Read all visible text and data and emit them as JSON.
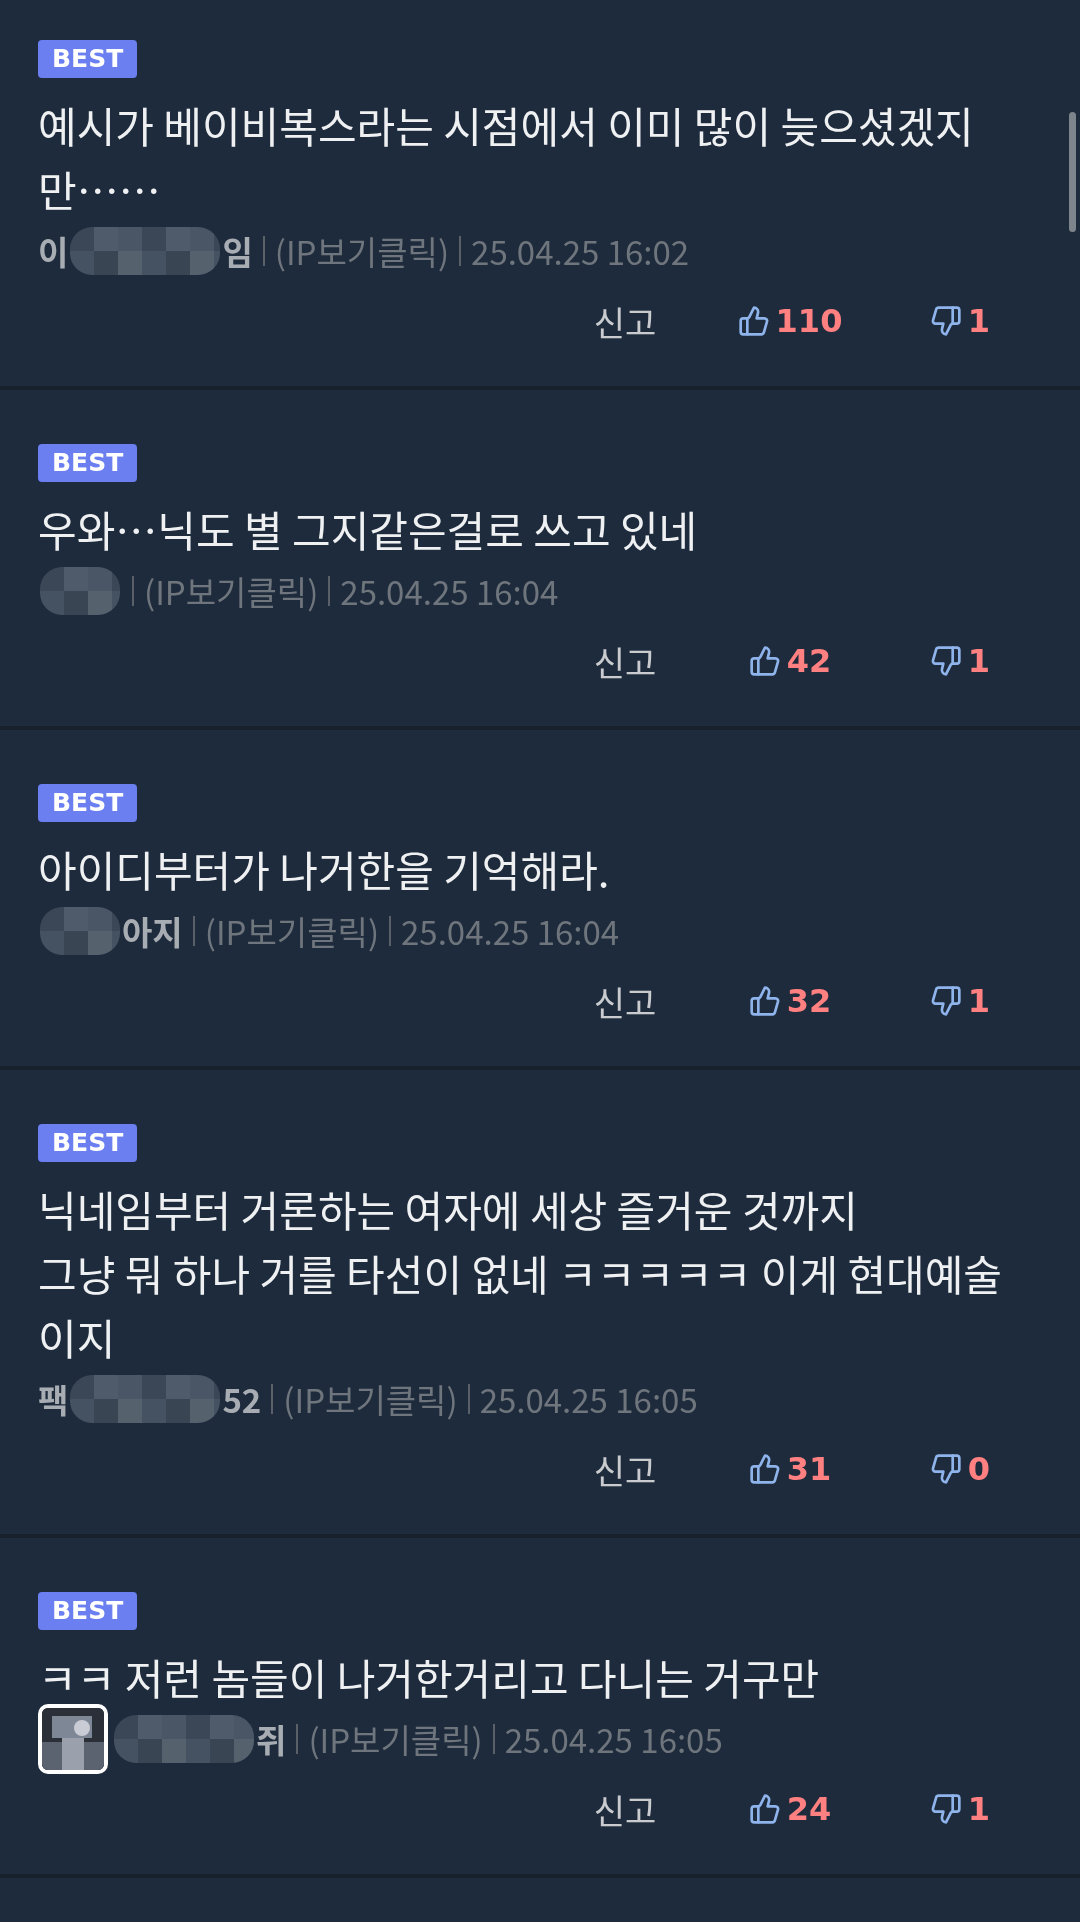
{
  "comments": [
    {
      "badge": "BEST",
      "text": "예시가 베이비복스라는 시점에서 이미 많이 늦으셨겠지만……",
      "author": {
        "prefix": "이",
        "suffix": "임",
        "has_avatar": false
      },
      "ip": "(IP보기클릭)",
      "date": "25.04.25 16:02",
      "report": "신고",
      "likes": "110",
      "dislikes": "1"
    },
    {
      "badge": "BEST",
      "text": "우와…닉도 별 그지같은걸로 쓰고 있네",
      "author": {
        "has_avatar": false
      },
      "ip": "(IP보기클릭)",
      "date": "25.04.25 16:04",
      "report": "신고",
      "likes": "42",
      "dislikes": "1"
    },
    {
      "badge": "BEST",
      "text": "아이디부터가 나거한을 기억해라.",
      "author": {
        "suffix": "아지",
        "has_avatar": false
      },
      "ip": "(IP보기클릭)",
      "date": "25.04.25 16:04",
      "report": "신고",
      "likes": "32",
      "dislikes": "1"
    },
    {
      "badge": "BEST",
      "text": "닉네임부터 거론하는 여자에 세상 즐거운 것까지\n그냥 뭐 하나 거를 타선이 없네 ㅋㅋㅋㅋㅋ 이게 현대예술이지",
      "author": {
        "prefix": "팩",
        "suffix": "52",
        "has_avatar": false
      },
      "ip": "(IP보기클릭)",
      "date": "25.04.25 16:05",
      "report": "신고",
      "likes": "31",
      "dislikes": "0"
    },
    {
      "badge": "BEST",
      "text": "ㅋㅋ 저런 놈들이 나거한거리고 다니는 거구만",
      "author": {
        "suffix": "쥐",
        "has_avatar": true
      },
      "ip": "(IP보기클릭)",
      "date": "25.04.25 16:05",
      "report": "신고",
      "likes": "24",
      "dislikes": "1"
    }
  ]
}
